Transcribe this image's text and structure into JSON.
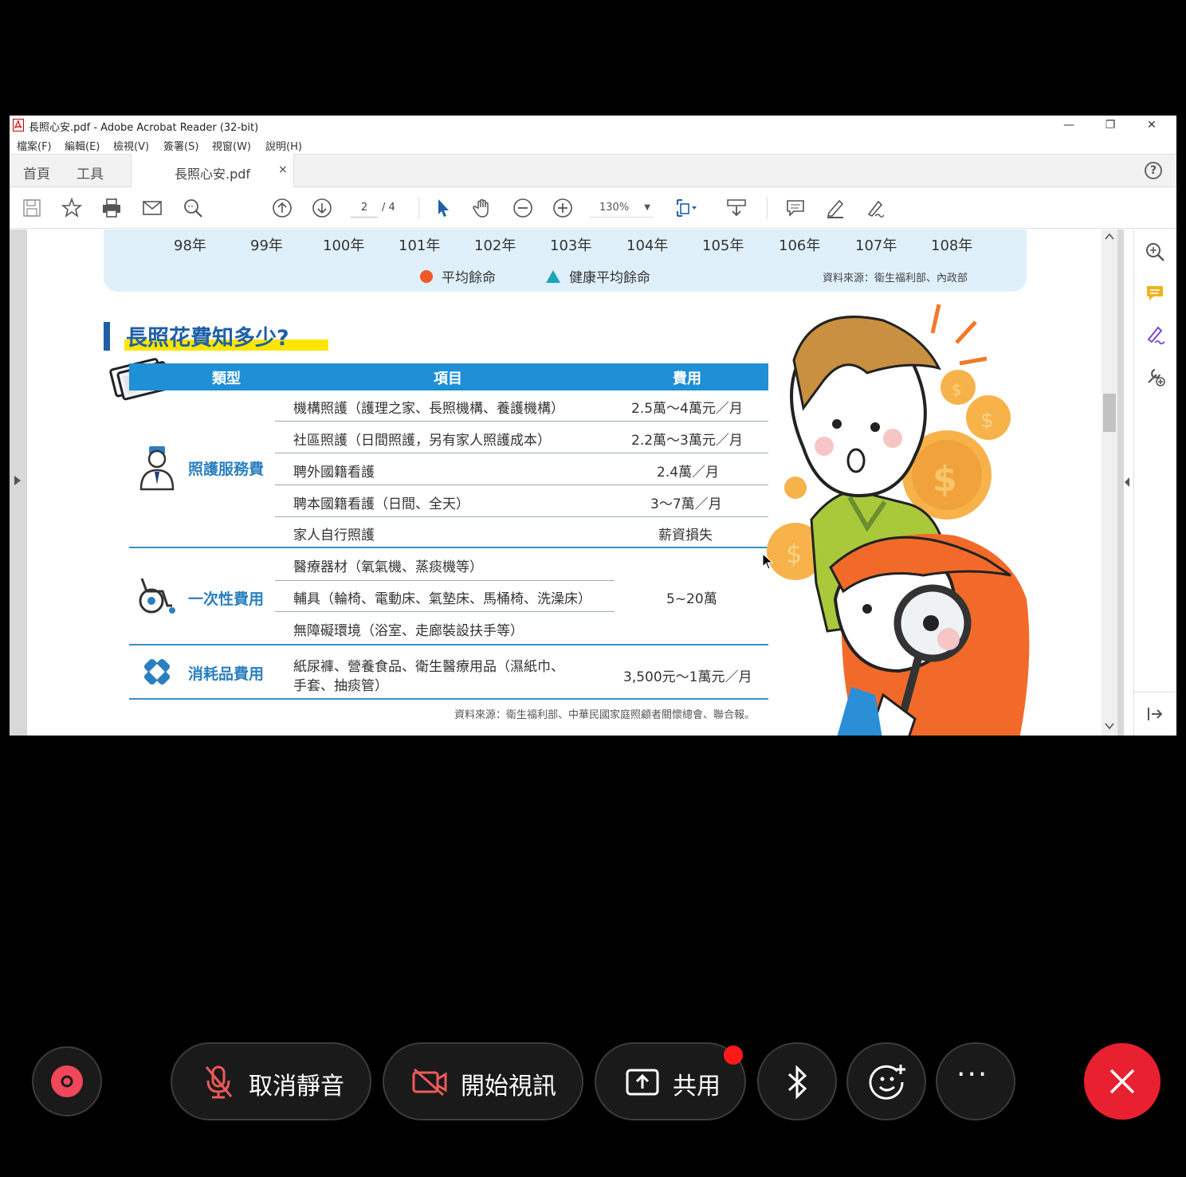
{
  "window": {
    "title": "長照心安.pdf - Adobe Acrobat Reader (32-bit)",
    "controls": {
      "minimize": "—",
      "restore": "❐",
      "close": "✕"
    }
  },
  "menu": [
    "檔案(F)",
    "編輯(E)",
    "檢視(V)",
    "簽署(S)",
    "視窗(W)",
    "說明(H)"
  ],
  "tabs": {
    "home": "首頁",
    "tools": "工具",
    "doc": "長照心安.pdf",
    "close": "×"
  },
  "toolbar": {
    "page_current": "2",
    "page_total": "/ 4",
    "zoom": "130%"
  },
  "chart_footer": {
    "years": [
      "98年",
      "99年",
      "100年",
      "101年",
      "102年",
      "103年",
      "104年",
      "105年",
      "106年",
      "107年",
      "108年"
    ],
    "legend": [
      {
        "label": "平均餘命",
        "color": "#f05a28",
        "shape": "circle"
      },
      {
        "label": "健康平均餘命",
        "color": "#1ba6b8",
        "shape": "triangle"
      }
    ],
    "source": "資料來源：衛生福利部、內政部"
  },
  "section": {
    "title": "長照花費知多少?",
    "headers": {
      "type": "類型",
      "item": "項目",
      "cost": "費用"
    },
    "categories": {
      "care": "照護服務費",
      "onetime": "一次性費用",
      "consumable": "消耗品費用"
    },
    "care_rows": [
      {
        "item": "機構照護（護理之家、長照機構、養護機構）",
        "cost": "2.5萬～4萬元／月"
      },
      {
        "item": "社區照護（日間照護，另有家人照護成本）",
        "cost": "2.2萬～3萬元／月"
      },
      {
        "item": "聘外國籍看護",
        "cost": "2.4萬／月"
      },
      {
        "item": "聘本國籍看護（日間、全天）",
        "cost": "3～7萬／月"
      },
      {
        "item": "家人自行照護",
        "cost": "薪資損失"
      }
    ],
    "onetime_rows": [
      {
        "item": "醫療器材（氧氣機、蒸痰機等）"
      },
      {
        "item": "輔具（輪椅、電動床、氣墊床、馬桶椅、洗澡床）"
      },
      {
        "item": "無障礙環境（浴室、走廊裝設扶手等）"
      }
    ],
    "onetime_cost": "5~20萬",
    "consumable_item_line1": "紙尿褲、營養食品、衛生醫療用品（濕紙巾、",
    "consumable_item_line2": "手套、抽痰管）",
    "consumable_cost": "3,500元～1萬元／月",
    "source": "資料來源：衛生福利部、中華民國家庭照顧者關懷總會、聯合報。"
  },
  "call": {
    "unmute": "取消靜音",
    "video": "開始視訊",
    "share": "共用",
    "more": "···"
  },
  "colors": {
    "accent": "#1f8fd6",
    "title_blue": "#1f5fa8",
    "highlight": "#ffe600",
    "end_call": "#e8202f"
  }
}
